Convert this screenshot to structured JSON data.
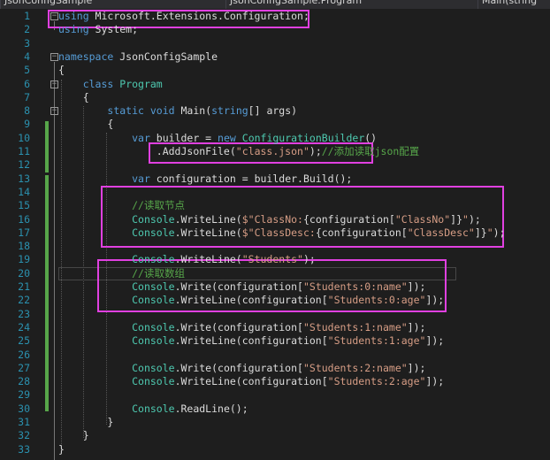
{
  "nav": {
    "project": "JsonConfigSample",
    "class": "JsonConfigSample.Program",
    "member": "Main(string"
  },
  "lines": [
    {
      "n": "1",
      "tokens": [
        {
          "t": "using",
          "c": "kw"
        },
        {
          "t": " Microsoft.Extensions.Configuration;",
          "c": "pl"
        }
      ]
    },
    {
      "n": "2",
      "tokens": [
        {
          "t": "using",
          "c": "kw"
        },
        {
          "t": " System;",
          "c": "pl"
        }
      ]
    },
    {
      "n": "3",
      "tokens": []
    },
    {
      "n": "4",
      "tokens": [
        {
          "t": "namespace",
          "c": "kw"
        },
        {
          "t": " JsonConfigSample",
          "c": "pl"
        }
      ]
    },
    {
      "n": "5",
      "tokens": [
        {
          "t": "{",
          "c": "pl"
        }
      ]
    },
    {
      "n": "6",
      "tokens": [
        {
          "t": "    ",
          "c": "pl"
        },
        {
          "t": "class",
          "c": "kw"
        },
        {
          "t": " ",
          "c": "pl"
        },
        {
          "t": "Program",
          "c": "ty"
        }
      ]
    },
    {
      "n": "7",
      "tokens": [
        {
          "t": "    {",
          "c": "pl"
        }
      ]
    },
    {
      "n": "8",
      "tokens": [
        {
          "t": "        ",
          "c": "pl"
        },
        {
          "t": "static",
          "c": "kw"
        },
        {
          "t": " ",
          "c": "pl"
        },
        {
          "t": "void",
          "c": "kw"
        },
        {
          "t": " Main(",
          "c": "pl"
        },
        {
          "t": "string",
          "c": "kw"
        },
        {
          "t": "[] args)",
          "c": "pl"
        }
      ]
    },
    {
      "n": "9",
      "tokens": [
        {
          "t": "        {",
          "c": "pl"
        }
      ]
    },
    {
      "n": "10",
      "tokens": [
        {
          "t": "            ",
          "c": "pl"
        },
        {
          "t": "var",
          "c": "kw"
        },
        {
          "t": " builder = ",
          "c": "pl"
        },
        {
          "t": "new",
          "c": "kw"
        },
        {
          "t": " ",
          "c": "pl"
        },
        {
          "t": "ConfigurationBuilder",
          "c": "ty"
        },
        {
          "t": "()",
          "c": "pl"
        }
      ]
    },
    {
      "n": "11",
      "tokens": [
        {
          "t": "                .AddJsonFile(",
          "c": "pl"
        },
        {
          "t": "\"class.json\"",
          "c": "st"
        },
        {
          "t": ");",
          "c": "pl"
        },
        {
          "t": "//添加读取json配置",
          "c": "cm"
        }
      ]
    },
    {
      "n": "12",
      "tokens": []
    },
    {
      "n": "13",
      "tokens": [
        {
          "t": "            ",
          "c": "pl"
        },
        {
          "t": "var",
          "c": "kw"
        },
        {
          "t": " configuration = builder.Build();",
          "c": "pl"
        }
      ]
    },
    {
      "n": "14",
      "tokens": []
    },
    {
      "n": "15",
      "tokens": [
        {
          "t": "            ",
          "c": "pl"
        },
        {
          "t": "//读取节点",
          "c": "cm"
        }
      ]
    },
    {
      "n": "16",
      "tokens": [
        {
          "t": "            ",
          "c": "pl"
        },
        {
          "t": "Console",
          "c": "ty"
        },
        {
          "t": ".WriteLine(",
          "c": "pl"
        },
        {
          "t": "$\"ClassNo:",
          "c": "st"
        },
        {
          "t": "{configuration[",
          "c": "pl"
        },
        {
          "t": "\"ClassNo\"",
          "c": "st"
        },
        {
          "t": "]}",
          "c": "pl"
        },
        {
          "t": "\"",
          "c": "st"
        },
        {
          "t": ");",
          "c": "pl"
        }
      ]
    },
    {
      "n": "17",
      "tokens": [
        {
          "t": "            ",
          "c": "pl"
        },
        {
          "t": "Console",
          "c": "ty"
        },
        {
          "t": ".WriteLine(",
          "c": "pl"
        },
        {
          "t": "$\"ClassDesc:",
          "c": "st"
        },
        {
          "t": "{configuration[",
          "c": "pl"
        },
        {
          "t": "\"ClassDesc\"",
          "c": "st"
        },
        {
          "t": "]}",
          "c": "pl"
        },
        {
          "t": "\"",
          "c": "st"
        },
        {
          "t": ");",
          "c": "pl"
        }
      ]
    },
    {
      "n": "18",
      "tokens": []
    },
    {
      "n": "19",
      "tokens": [
        {
          "t": "            ",
          "c": "pl"
        },
        {
          "t": "Console",
          "c": "ty"
        },
        {
          "t": ".WriteLine(",
          "c": "pl"
        },
        {
          "t": "\"Students\"",
          "c": "st"
        },
        {
          "t": ");",
          "c": "pl"
        }
      ]
    },
    {
      "n": "20",
      "tokens": [
        {
          "t": "            ",
          "c": "pl"
        },
        {
          "t": "//读取数组",
          "c": "cm"
        }
      ]
    },
    {
      "n": "21",
      "tokens": [
        {
          "t": "            ",
          "c": "pl"
        },
        {
          "t": "Console",
          "c": "ty"
        },
        {
          "t": ".Write(configuration[",
          "c": "pl"
        },
        {
          "t": "\"Students:0:name\"",
          "c": "st"
        },
        {
          "t": "]);",
          "c": "pl"
        }
      ]
    },
    {
      "n": "22",
      "tokens": [
        {
          "t": "            ",
          "c": "pl"
        },
        {
          "t": "Console",
          "c": "ty"
        },
        {
          "t": ".WriteLine(configuration[",
          "c": "pl"
        },
        {
          "t": "\"Students:0:age\"",
          "c": "st"
        },
        {
          "t": "]);",
          "c": "pl"
        }
      ]
    },
    {
      "n": "23",
      "tokens": []
    },
    {
      "n": "24",
      "tokens": [
        {
          "t": "            ",
          "c": "pl"
        },
        {
          "t": "Console",
          "c": "ty"
        },
        {
          "t": ".Write(configuration[",
          "c": "pl"
        },
        {
          "t": "\"Students:1:name\"",
          "c": "st"
        },
        {
          "t": "]);",
          "c": "pl"
        }
      ]
    },
    {
      "n": "25",
      "tokens": [
        {
          "t": "            ",
          "c": "pl"
        },
        {
          "t": "Console",
          "c": "ty"
        },
        {
          "t": ".WriteLine(configuration[",
          "c": "pl"
        },
        {
          "t": "\"Students:1:age\"",
          "c": "st"
        },
        {
          "t": "]);",
          "c": "pl"
        }
      ]
    },
    {
      "n": "26",
      "tokens": []
    },
    {
      "n": "27",
      "tokens": [
        {
          "t": "            ",
          "c": "pl"
        },
        {
          "t": "Console",
          "c": "ty"
        },
        {
          "t": ".Write(configuration[",
          "c": "pl"
        },
        {
          "t": "\"Students:2:name\"",
          "c": "st"
        },
        {
          "t": "]);",
          "c": "pl"
        }
      ]
    },
    {
      "n": "28",
      "tokens": [
        {
          "t": "            ",
          "c": "pl"
        },
        {
          "t": "Console",
          "c": "ty"
        },
        {
          "t": ".WriteLine(configuration[",
          "c": "pl"
        },
        {
          "t": "\"Students:2:age\"",
          "c": "st"
        },
        {
          "t": "]);",
          "c": "pl"
        }
      ]
    },
    {
      "n": "29",
      "tokens": []
    },
    {
      "n": "30",
      "tokens": [
        {
          "t": "            ",
          "c": "pl"
        },
        {
          "t": "Console",
          "c": "ty"
        },
        {
          "t": ".ReadLine();",
          "c": "pl"
        }
      ]
    },
    {
      "n": "31",
      "tokens": [
        {
          "t": "        }",
          "c": "pl"
        }
      ]
    },
    {
      "n": "32",
      "tokens": [
        {
          "t": "    }",
          "c": "pl"
        }
      ]
    },
    {
      "n": "33",
      "tokens": [
        {
          "t": "}",
          "c": "pl"
        }
      ]
    }
  ],
  "colors": {
    "background": "#1e1e1e",
    "keyword": "#569cd6",
    "type": "#4ec9b0",
    "string": "#d69d85",
    "comment": "#57a64a",
    "line_number": "#2b91af",
    "highlight_box": "#e040e0"
  },
  "icons": {
    "fold_collapse": "minus-box-icon"
  }
}
